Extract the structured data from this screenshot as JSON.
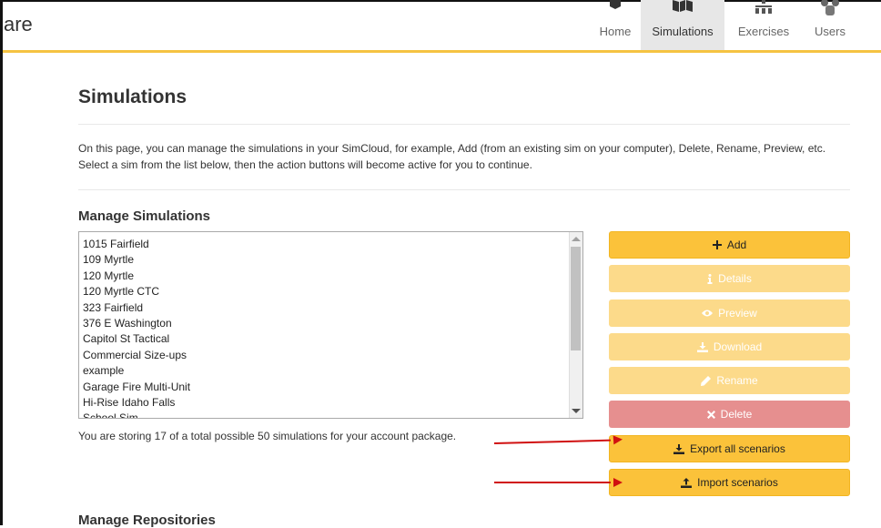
{
  "brand": {
    "text": "are"
  },
  "nav": {
    "items": [
      {
        "label": "Home",
        "icon": "home-icon"
      },
      {
        "label": "Simulations",
        "icon": "map-icon",
        "active": true
      },
      {
        "label": "Exercises",
        "icon": "network-icon"
      },
      {
        "label": "Users",
        "icon": "users-icon"
      }
    ]
  },
  "page": {
    "title": "Simulations",
    "intro": "On this page, you can manage the simulations in your SimCloud, for example, Add (from an existing sim on your computer), Delete, Rename, Preview, etc. Select a sim from the list below, then the action buttons will become active for you to continue."
  },
  "manage": {
    "heading": "Manage Simulations",
    "simulations": [
      "1015 Fairfield",
      "109 Myrtle",
      "120 Myrtle",
      "120 Myrtle CTC",
      "323 Fairfield",
      "376 E Washington",
      "Capitol St Tactical",
      "Commercial Size-ups",
      "example",
      "Garage Fire Multi-Unit",
      "Hi-Rise Idaho Falls",
      "School Sim"
    ],
    "storage_note": "You are storing 17 of a total possible 50 simulations for your account package.",
    "buttons": {
      "add": "Add",
      "details": "Details",
      "preview": "Preview",
      "download": "Download",
      "rename": "Rename",
      "delete": "Delete",
      "export_all": "Export all scenarios",
      "import": "Import scenarios"
    }
  },
  "repositories": {
    "heading": "Manage Repositories"
  },
  "colors": {
    "accent": "#fbc23a",
    "accent_disabled": "#fcda8a",
    "danger": "#e68f8f",
    "annotation_arrow": "#d01010"
  }
}
